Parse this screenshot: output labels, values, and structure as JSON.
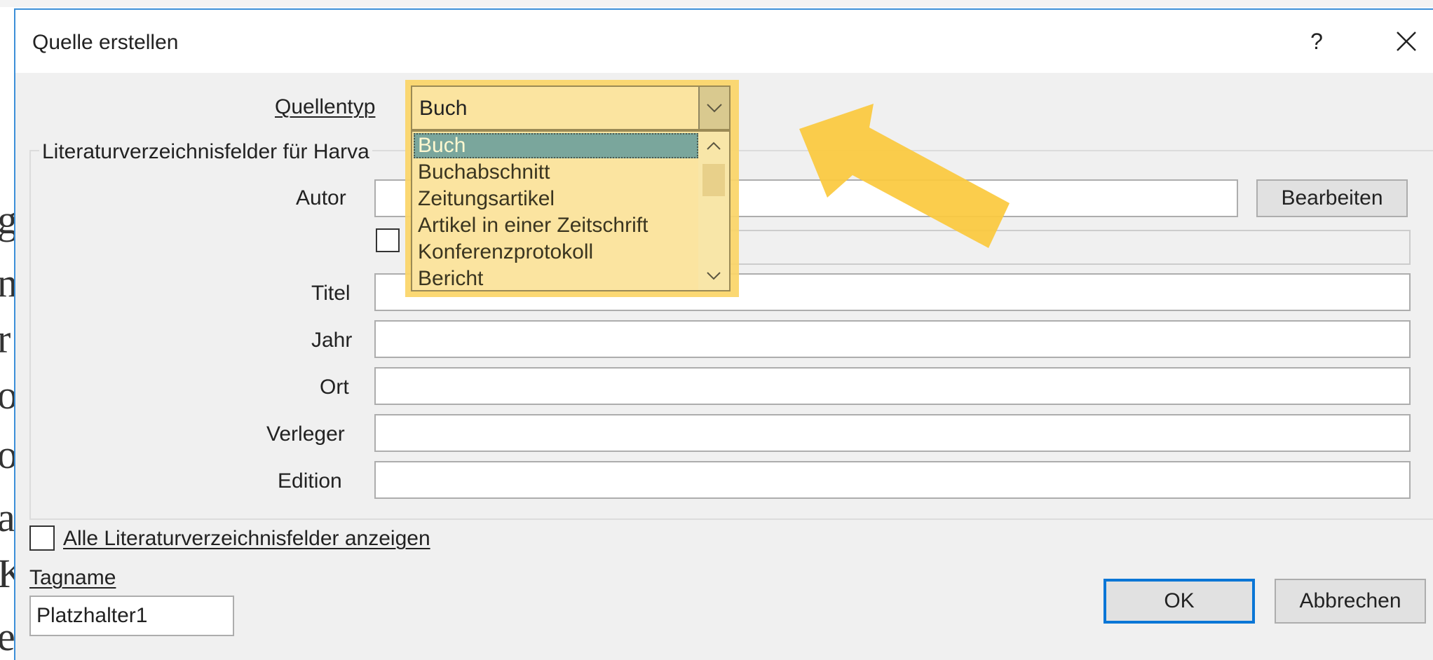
{
  "dialog": {
    "title": "Quelle erstellen",
    "help_label": "?",
    "close_label": "close"
  },
  "source_type": {
    "label": "Quellentyp",
    "value": "Buch",
    "options": [
      "Buch",
      "Buchabschnitt",
      "Zeitungsartikel",
      "Artikel in einer Zeitschrift",
      "Konferenzprotokoll",
      "Bericht"
    ],
    "selected_index": 0
  },
  "fields_group": {
    "title": "Literaturverzeichnisfelder für Harva"
  },
  "fields": {
    "author_label": "Autor",
    "edit_button": "Bearbeiten",
    "title_label": "Titel",
    "year_label": "Jahr",
    "city_label": "Ort",
    "publisher_label": "Verleger",
    "edition_label": "Edition"
  },
  "show_all": {
    "label": "Alle Literaturverzeichnisfelder anzeigen",
    "checked": false
  },
  "tag": {
    "label": "Tagname",
    "value": "Platzhalter1"
  },
  "buttons": {
    "ok": "OK",
    "cancel": "Abbrechen"
  },
  "background_letters": [
    "g",
    "nc",
    "r",
    "o",
    "o",
    "a",
    "K",
    "e"
  ],
  "colors": {
    "highlight": "#fbd567",
    "dialog_border": "#3c8fd8",
    "default_button_border": "#0a76d6",
    "selected_item": "#7aa69c"
  }
}
